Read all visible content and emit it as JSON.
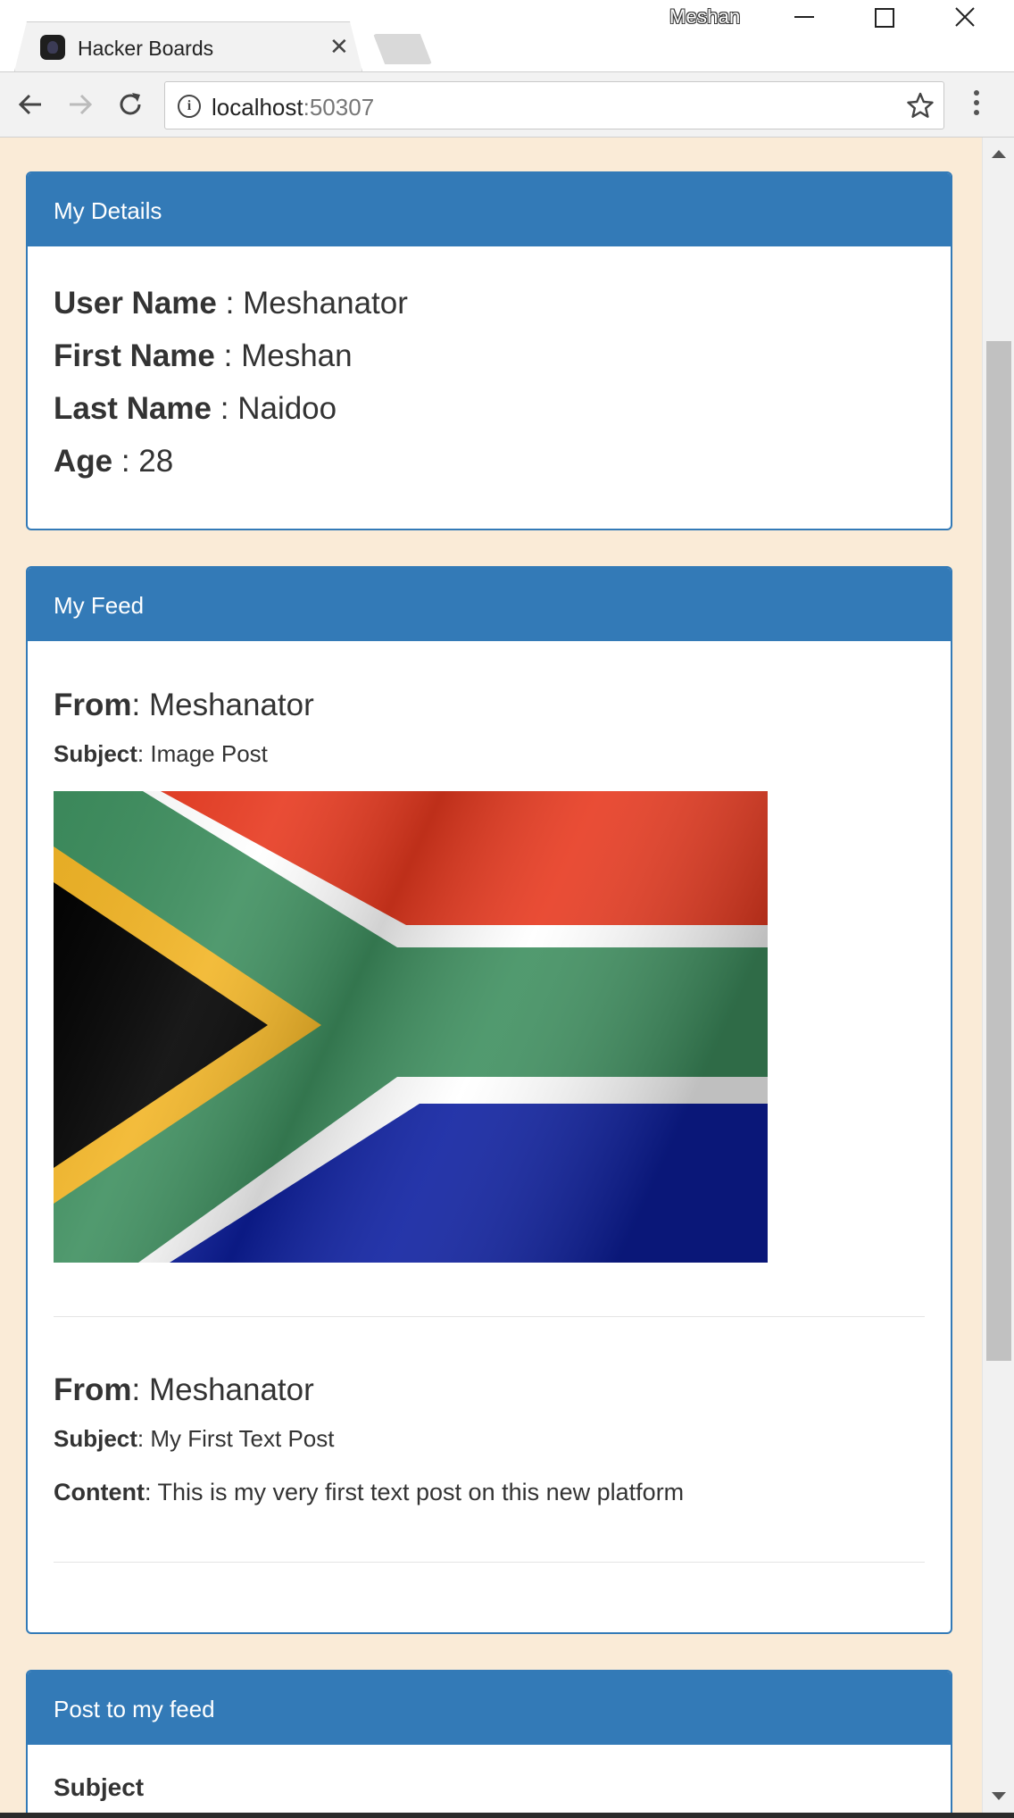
{
  "browser": {
    "tab_title": "Hacker Boards",
    "profile_name": "Meshan",
    "url_host": "localhost",
    "url_port": ":50307"
  },
  "details": {
    "heading": "My Details",
    "rows": [
      {
        "label": "User Name",
        "value": " : Meshanator"
      },
      {
        "label": "First Name",
        "value": " : Meshan"
      },
      {
        "label": "Last Name",
        "value": " : Naidoo"
      },
      {
        "label": "Age",
        "value": " : 28"
      }
    ]
  },
  "feed": {
    "heading": "My Feed",
    "labels": {
      "from": "From",
      "subject": "Subject",
      "content": "Content"
    },
    "posts": [
      {
        "from": ": Meshanator",
        "subject": ": Image Post",
        "image": "south-african-flag"
      },
      {
        "from": ": Meshanator",
        "subject": ": My First Text Post",
        "content": ": This is my very first text post on this new platform"
      }
    ]
  },
  "post_form": {
    "heading": "Post to my feed",
    "subject_label": "Subject"
  },
  "colors": {
    "page_background": "#faebd7",
    "panel_primary": "#337ab7"
  }
}
